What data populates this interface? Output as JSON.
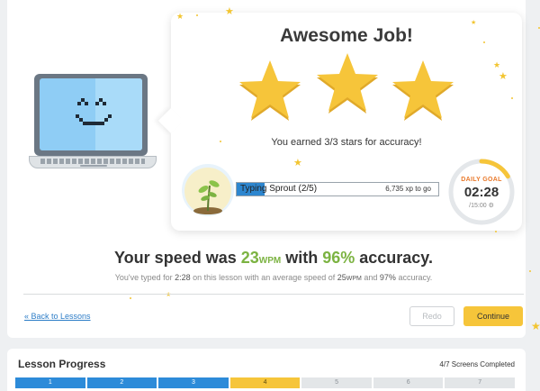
{
  "card": {
    "title": "Awesome Job!",
    "stars_earned": 3,
    "stars_total": 3,
    "star_message": "You earned 3/3 stars for accuracy!"
  },
  "level": {
    "label": "Typing Sprout (2/5)",
    "xp_to_go": "6,735 xp to go",
    "progress_fraction": 0.14
  },
  "daily_goal": {
    "label": "DAILY GOAL",
    "time": "02:28",
    "target": "/15:00",
    "progress_fraction": 0.165
  },
  "summary": {
    "speed_prefix": "Your speed was ",
    "wpm": "23",
    "wpm_unit": "WPM",
    "speed_mid": " with ",
    "accuracy": "96%",
    "speed_suffix": " accuracy.",
    "detail_prefix": "You've typed for ",
    "detail_time": "2:28",
    "detail_mid": " on this lesson with an average speed of ",
    "detail_avg_wpm": "25",
    "detail_unit": "WPM",
    "detail_and": " and ",
    "detail_avg_acc": "97%",
    "detail_suffix": " accuracy."
  },
  "actions": {
    "back_link": "« Back to Lessons",
    "redo": "Redo",
    "continue": "Continue"
  },
  "lesson_progress": {
    "title": "Lesson Progress",
    "completed": "4/7 Screens Completed",
    "screens": [
      {
        "label": "1",
        "state": "done"
      },
      {
        "label": "2",
        "state": "done"
      },
      {
        "label": "3",
        "state": "done"
      },
      {
        "label": "4",
        "state": "current"
      },
      {
        "label": "5",
        "state": "todo"
      },
      {
        "label": "6",
        "state": "todo"
      },
      {
        "label": "7",
        "state": "todo"
      }
    ]
  },
  "colors": {
    "star": "#f6c53a",
    "accent_green": "#7cb342",
    "accent_blue": "#2d8bd9",
    "continue_yellow": "#f6c53a"
  }
}
